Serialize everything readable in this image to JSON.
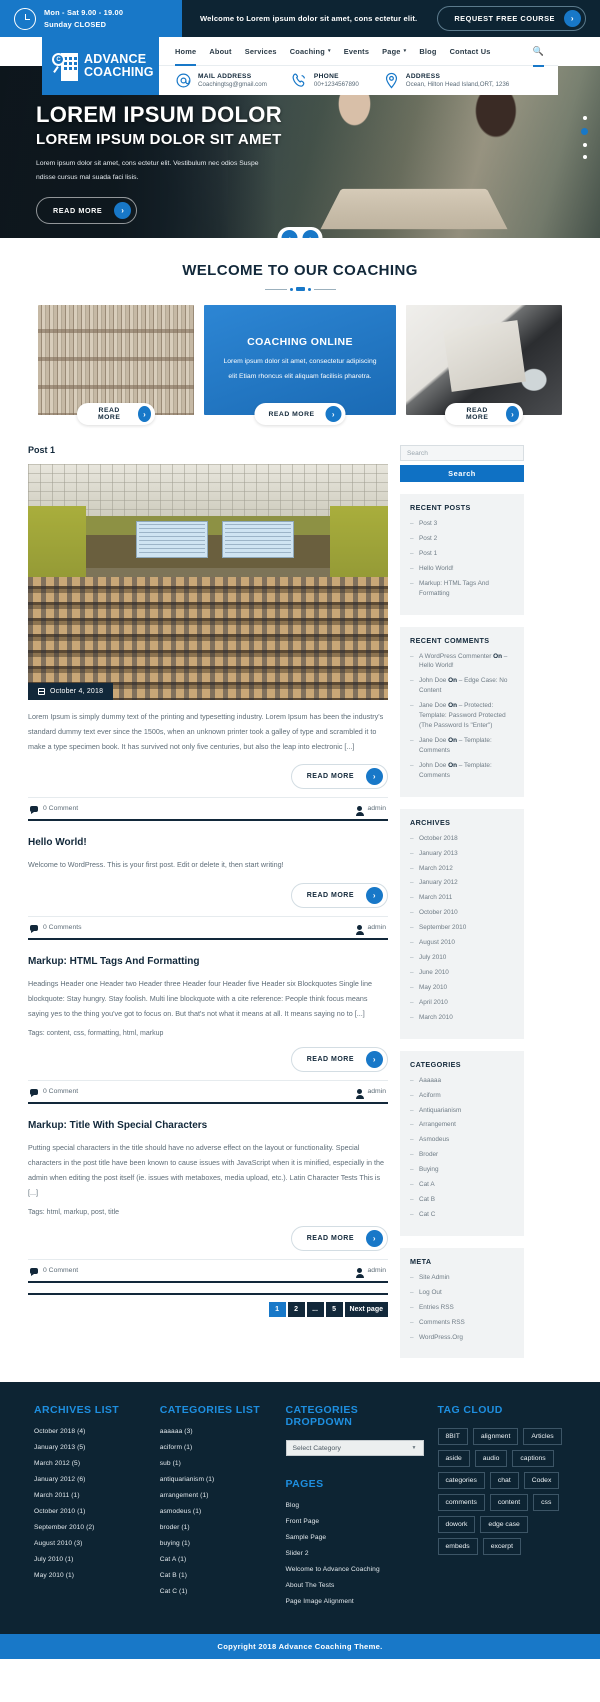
{
  "topbar": {
    "hours_line1": "Mon - Sat 9.00 - 19.00",
    "hours_line2": "Sunday CLOSED",
    "welcome": "Welcome to Lorem ipsum dolor sit amet, cons ectetur elit.",
    "cta_label": "REQUEST FREE COURSE"
  },
  "header": {
    "logo_line1": "ADVANCE",
    "logo_line2": "COACHING",
    "logo_letter": "C",
    "nav": [
      {
        "label": "Home",
        "caret": false,
        "active": true
      },
      {
        "label": "About",
        "caret": false,
        "active": false
      },
      {
        "label": "Services",
        "caret": false,
        "active": false
      },
      {
        "label": "Coaching",
        "caret": true,
        "active": false
      },
      {
        "label": "Events",
        "caret": false,
        "active": false
      },
      {
        "label": "Page",
        "caret": true,
        "active": false
      },
      {
        "label": "Blog",
        "caret": false,
        "active": false
      },
      {
        "label": "Contact Us",
        "caret": false,
        "active": false
      }
    ],
    "contacts": [
      {
        "label": "MAIL ADDRESS",
        "value": "Coachingtsg@gmail.com",
        "icon": "at-icon"
      },
      {
        "label": "PHONE",
        "value": "00+1234567890",
        "icon": "phone-icon"
      },
      {
        "label": "ADDRESS",
        "value": "Ocean, Hilton Head Island,ORT, 1236",
        "icon": "map-pin-icon"
      }
    ]
  },
  "hero": {
    "title": "LOREM IPSUM DOLOR",
    "subtitle": "LOREM IPSUM DOLOR SIT AMET",
    "paragraph": "Lorem ipsum dolor sit amet, cons ectetur elit. Vestibulum nec odios Suspe ndisse cursus mal suada faci lisis.",
    "button": "READ MORE",
    "dots": 4,
    "active_dot": 2
  },
  "welcome": {
    "title": "WELCOME TO OUR COACHING",
    "cards": [
      {
        "type": "image",
        "button": "READ MORE"
      },
      {
        "type": "blue",
        "heading": "COACHING ONLINE",
        "text": "Lorem ipsum dolor sit amet, consectetur adipiscing elit Etiam rhoncus elit aliquam facilisis pharetra.",
        "button": "READ MORE"
      },
      {
        "type": "image",
        "button": "READ MORE"
      }
    ]
  },
  "blog": {
    "first_post_title": "Post 1",
    "featured_date": "October 4, 2018",
    "first_post_body": "Lorem Ipsum is simply dummy text of the printing and typesetting industry. Lorem Ipsum has been the industry's standard dummy text ever since the 1500s, when an unknown printer took a galley of type and scrambled it to make a type specimen book. It has survived not only five centuries, but also the leap into electronic [...]",
    "read_more": "READ MORE",
    "posts": [
      {
        "title": "Hello World!",
        "body": "Welcome to WordPress. This is your first post. Edit or delete it, then start writing!",
        "tags": "",
        "comments": "0 Comments",
        "author": "admin"
      },
      {
        "title": "Markup: HTML Tags And Formatting",
        "body": "Headings Header one Header two Header three Header four Header five Header six Blockquotes Single line blockquote: Stay hungry. Stay foolish. Multi line blockquote with a cite reference: People think focus means saying yes to the thing you've got to focus on. But that's not what it means at all. It means saying no to [...]",
        "tags": "Tags: content, css, formatting, html, markup",
        "comments": "0 Comment",
        "author": "admin"
      },
      {
        "title": "Markup: Title With Special Characters",
        "body": "Putting special characters in the title should have no adverse effect on the layout or functionality. Special characters in the post title have been known to cause issues with JavaScript when it is minified, especially in the admin when editing the post itself (ie. issues with metaboxes, media upload, etc.). Latin Character Tests This is [...]",
        "tags": "Tags: html, markup, post, title",
        "comments": "0 Comment",
        "author": "admin"
      }
    ],
    "first_post_comments": "0 Comment",
    "first_post_author": "admin",
    "pagination": [
      "1",
      "2",
      "...",
      "5",
      "Next page"
    ]
  },
  "sidebar": {
    "search_placeholder": "Search",
    "search_button": "Search",
    "recent_posts": {
      "title": "RECENT POSTS",
      "items": [
        "Post 3",
        "Post 2",
        "Post 1",
        "Hello World!",
        "Markup: HTML Tags And Formatting"
      ]
    },
    "recent_comments": {
      "title": "RECENT COMMENTS",
      "items": [
        {
          "author": "A WordPress Commenter",
          "on": "On",
          "post": "Hello World!"
        },
        {
          "author": "John Doe",
          "on": "On",
          "post": "Edge Case: No Content"
        },
        {
          "author": "Jane Doe",
          "on": "On",
          "post": "Protected: Template: Password Protected (The Password Is \"Enter\")"
        },
        {
          "author": "Jane Doe",
          "on": "On",
          "post": "Template: Comments"
        },
        {
          "author": "John Doe",
          "on": "On",
          "post": "Template: Comments"
        }
      ]
    },
    "archives": {
      "title": "ARCHIVES",
      "items": [
        "October 2018",
        "January 2013",
        "March 2012",
        "January 2012",
        "March 2011",
        "October 2010",
        "September 2010",
        "August 2010",
        "July 2010",
        "June 2010",
        "May 2010",
        "April 2010",
        "March 2010"
      ]
    },
    "categories": {
      "title": "CATEGORIES",
      "items": [
        "Aaaaaa",
        "Aciform",
        "Antiquarianism",
        "Arrangement",
        "Asmodeus",
        "Broder",
        "Buying",
        "Cat A",
        "Cat B",
        "Cat C"
      ]
    },
    "meta": {
      "title": "META",
      "items": [
        "Site Admin",
        "Log Out",
        "Entries RSS",
        "Comments RSS",
        "WordPress.Org"
      ]
    }
  },
  "footer": {
    "archives_list": {
      "title": "ARCHIVES LIST",
      "items": [
        "October 2018 (4)",
        "January 2013 (5)",
        "March 2012 (5)",
        "January 2012 (6)",
        "March 2011 (1)",
        "October 2010 (1)",
        "September 2010 (2)",
        "August 2010 (3)",
        "July 2010 (1)",
        "May 2010 (1)"
      ]
    },
    "categories_list": {
      "title": "CATEGORIES LIST",
      "items": [
        "aaaaaa (3)",
        "aciform (1)",
        "sub (1)",
        "antiquarianism (1)",
        "arrangement (1)",
        "asmodeus (1)",
        "broder (1)",
        "buying (1)",
        "Cat A (1)",
        "Cat B (1)",
        "Cat C (1)"
      ]
    },
    "categories_dropdown": {
      "title": "CATEGORIES DROPDOWN",
      "selected": "Select Category"
    },
    "pages": {
      "title": "PAGES",
      "items": [
        "Blog",
        "Front Page",
        "Sample Page",
        "Slider 2",
        "Welcome to Advance Coaching",
        "About The Tests",
        "Page Image Alignment"
      ]
    },
    "tag_cloud": {
      "title": "TAG CLOUD",
      "tags": [
        "8BIT",
        "alignment",
        "Articles",
        "aside",
        "audio",
        "captions",
        "categories",
        "chat",
        "Codex",
        "comments",
        "content",
        "css",
        "dowork",
        "edge case",
        "embeds",
        "excerpt"
      ]
    },
    "copyright": "Copyright 2018 Advance Coaching Theme."
  }
}
